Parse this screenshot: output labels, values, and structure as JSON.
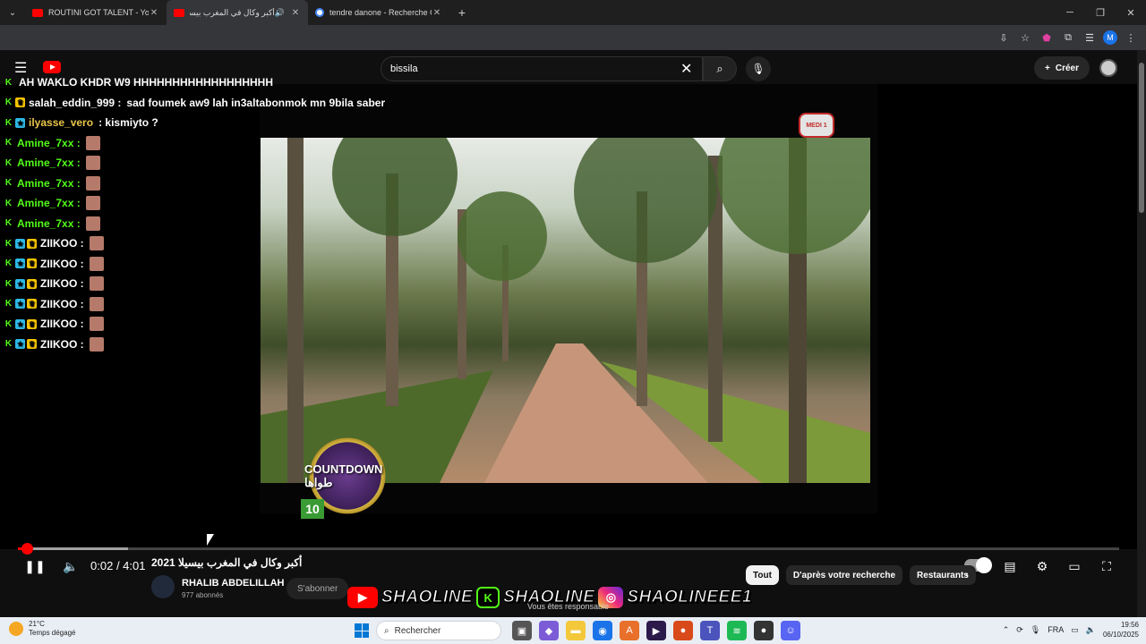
{
  "browser": {
    "tabs": [
      {
        "label": "ROUTINI GOT TALENT - YouTub",
        "favicon": "youtube-icon",
        "active": false
      },
      {
        "label": "أكبر وكال في المغرب بيسيلا",
        "favicon": "youtube-icon",
        "active": true,
        "audio": true
      },
      {
        "label": "tendre danone - Recherche Go",
        "favicon": "google-icon",
        "active": false
      }
    ],
    "new_tab": "+",
    "profile_initial": "M"
  },
  "youtube": {
    "search": {
      "value": "bissila"
    },
    "create_label": "Créer",
    "video": {
      "channel_logo": "MEDI 1",
      "countdown_text": "COUNTDOWN طواها",
      "countdown_number": "10"
    },
    "player": {
      "time_current": "0:02",
      "time_total": "4:01",
      "progress_fraction": 0.0083,
      "buffer_fraction": 0.1
    },
    "title": "أكبر وكال في المغرب بيسيلا 2021",
    "channel_name": "RHALIB ABDELILLAH",
    "subscribers": "977 abonnés",
    "subscribe_label": "S'abonner",
    "chips": [
      "Tout",
      "D'après votre recherche",
      "Restaurants"
    ],
    "under_caption": "Vous êtes responsable"
  },
  "chat": [
    {
      "badges": [
        "kick"
      ],
      "user": "",
      "user_color": "#ff4d4d",
      "msg": "AH WAKLO KHDR W9 HHHHHHHHHHHHHHHHHH"
    },
    {
      "badges": [
        "kick",
        "crown"
      ],
      "user": "salah_eddin_999 :",
      "user_color": "#ffffff",
      "msg": "sad foumek aw9 lah in3altabonmok mn 9bila saber"
    },
    {
      "badges": [
        "kick",
        "star"
      ],
      "user": "ilyasse_vero",
      "user_color": "#e8c548",
      "msg": ": kismiyto ?"
    },
    {
      "badges": [
        "kick"
      ],
      "user": "Amine_7xx :",
      "user_color": "#53fc18",
      "msg": "",
      "emote": true
    },
    {
      "badges": [
        "kick"
      ],
      "user": "Amine_7xx :",
      "user_color": "#53fc18",
      "msg": "",
      "emote": true
    },
    {
      "badges": [
        "kick"
      ],
      "user": "Amine_7xx :",
      "user_color": "#53fc18",
      "msg": "",
      "emote": true
    },
    {
      "badges": [
        "kick"
      ],
      "user": "Amine_7xx :",
      "user_color": "#53fc18",
      "msg": "",
      "emote": true
    },
    {
      "badges": [
        "kick"
      ],
      "user": "Amine_7xx :",
      "user_color": "#53fc18",
      "msg": "",
      "emote": true
    },
    {
      "badges": [
        "kick",
        "star",
        "crown"
      ],
      "user": "ZIIKOO :",
      "user_color": "#ffffff",
      "msg": "",
      "emote": true
    },
    {
      "badges": [
        "kick",
        "star",
        "crown"
      ],
      "user": "ZIIKOO :",
      "user_color": "#ffffff",
      "msg": "",
      "emote": true
    },
    {
      "badges": [
        "kick",
        "star",
        "crown"
      ],
      "user": "ZIIKOO :",
      "user_color": "#ffffff",
      "msg": "",
      "emote": true
    },
    {
      "badges": [
        "kick",
        "star",
        "crown"
      ],
      "user": "ZIIKOO :",
      "user_color": "#ffffff",
      "msg": "",
      "emote": true
    },
    {
      "badges": [
        "kick",
        "star",
        "crown"
      ],
      "user": "ZIIKOO :",
      "user_color": "#ffffff",
      "msg": "",
      "emote": true
    },
    {
      "badges": [
        "kick",
        "star",
        "crown"
      ],
      "user": "ZIIKOO :",
      "user_color": "#ffffff",
      "msg": "",
      "emote": true
    }
  ],
  "banner": {
    "items": [
      "SHAOLINE",
      "SHAOLINE",
      "SHAOLINEEE1"
    ]
  },
  "taskbar": {
    "weather_temp": "21°C",
    "weather_desc": "Temps dégagé",
    "search_label": "Rechercher",
    "lang": "FRA",
    "time": "19:56",
    "date": "06/10/2025"
  },
  "colors": {
    "accent": "#ff0000",
    "kick_green": "#53fc18"
  }
}
